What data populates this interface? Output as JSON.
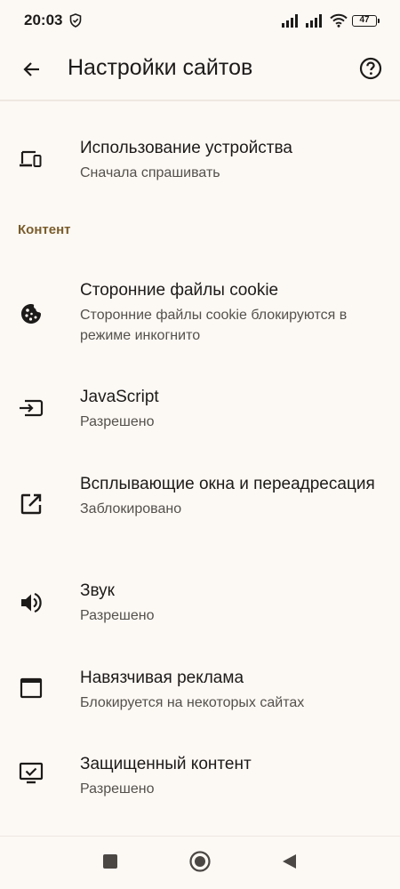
{
  "status_bar": {
    "time": "20:03",
    "battery_level": "47",
    "icons": [
      "shield-icon",
      "signal-icon",
      "signal-icon",
      "wifi-icon",
      "battery-icon"
    ]
  },
  "app_bar": {
    "back_icon": "arrow-back-icon",
    "title": "Настройки сайтов",
    "help_icon": "help-icon"
  },
  "settings": {
    "device_usage": {
      "title": "Использование устройства",
      "subtitle": "Сначала спрашивать",
      "icon": "devices-icon"
    },
    "content_header": "Контент",
    "items": [
      {
        "title": "Сторонние файлы cookie",
        "subtitle": "Сторонние файлы cookie блокируются в режиме инкогнито",
        "icon": "cookie-icon"
      },
      {
        "title": "JavaScript",
        "subtitle": "Разрешено",
        "icon": "javascript-icon"
      },
      {
        "title": "Всплывающие окна и переадресация",
        "subtitle": "Заблокировано",
        "icon": "open-in-new-icon"
      },
      {
        "title": "Звук",
        "subtitle": "Разрешено",
        "icon": "volume-icon"
      },
      {
        "title": "Навязчивая реклама",
        "subtitle": "Блокируется на некоторых сайтах",
        "icon": "web-asset-icon"
      },
      {
        "title": "Защищенный контент",
        "subtitle": "Разрешено",
        "icon": "protected-content-icon"
      }
    ]
  },
  "nav_bar": {
    "icons": [
      "recents-square-icon",
      "home-circle-icon",
      "back-triangle-icon"
    ]
  },
  "colors": {
    "background": "#fcf8f4",
    "text_primary": "#1d1b19",
    "text_secondary": "#54504b",
    "section_accent": "#7a5d2b"
  }
}
